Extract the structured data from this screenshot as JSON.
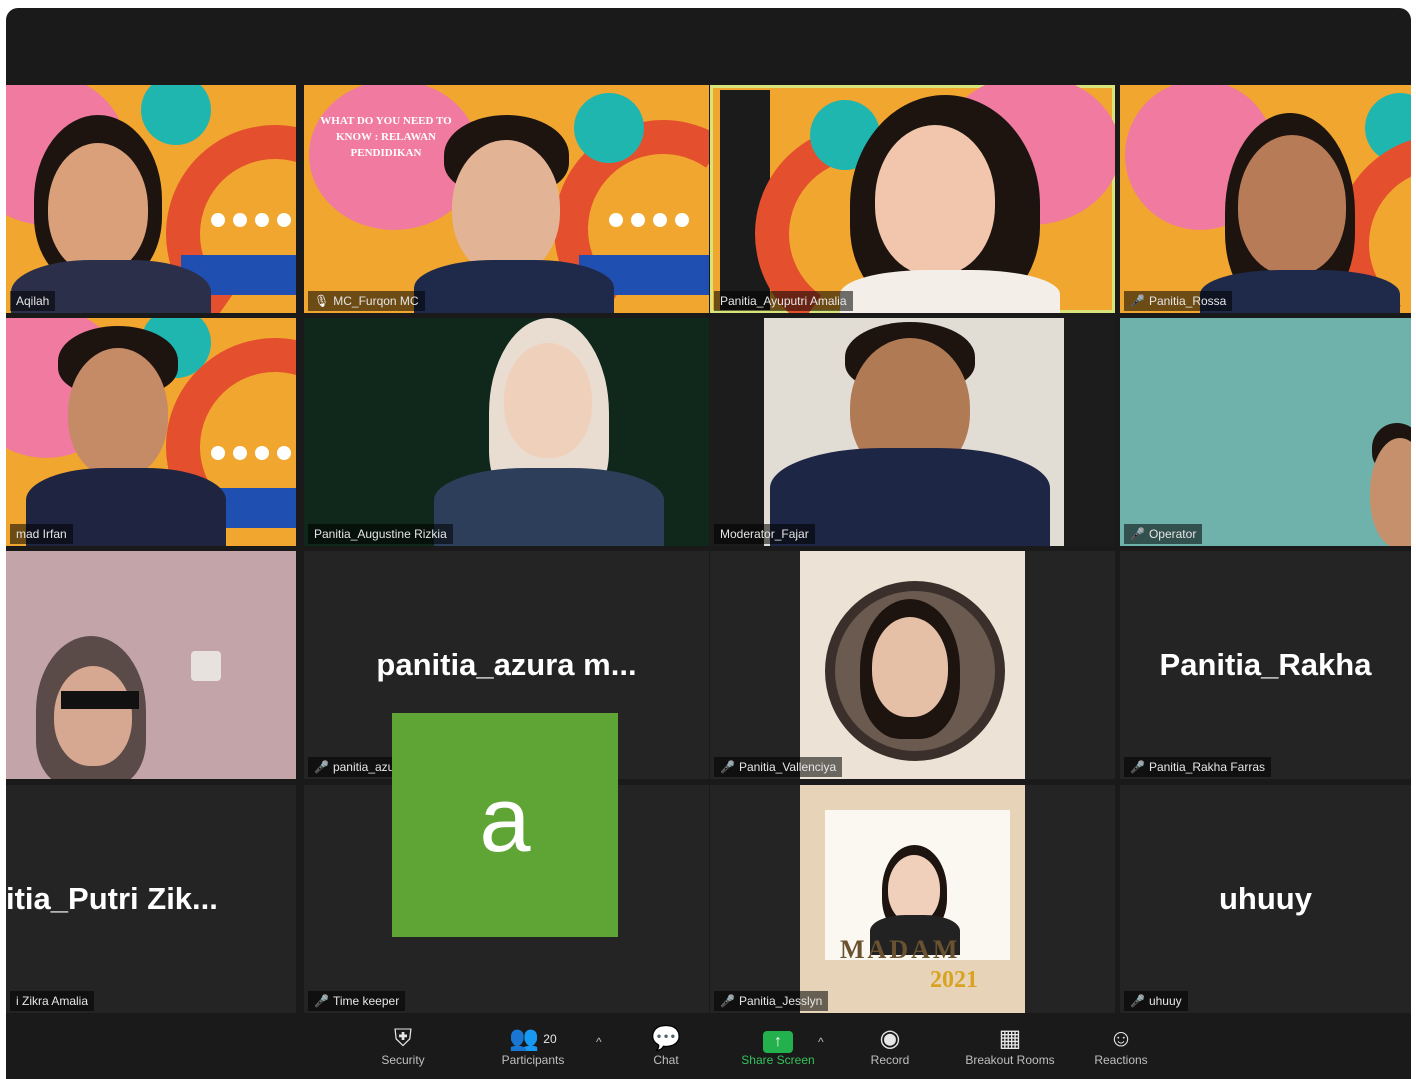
{
  "tiles": [
    {
      "label": "Aqilah",
      "muted": false,
      "mic": false
    },
    {
      "label": "MC_Furqon MC",
      "muted": false,
      "mic": true
    },
    {
      "label": "Panitia_Ayuputri Amalia",
      "muted": false,
      "mic": false
    },
    {
      "label": "Panitia_Rossa",
      "muted": true,
      "mic": false
    },
    {
      "label": "mad Irfan",
      "muted": false,
      "mic": false
    },
    {
      "label": "Panitia_Augustine Rizkia",
      "muted": false,
      "mic": false
    },
    {
      "label": "Moderator_Fajar",
      "muted": false,
      "mic": false
    },
    {
      "label": "Operator",
      "muted": true,
      "mic": false
    },
    {
      "label": "",
      "muted": false,
      "mic": false
    },
    {
      "label": "panitia_azura marha",
      "display": "panitia_azura  m...",
      "muted": true
    },
    {
      "label": "Panitia_Vallenciya",
      "muted": true
    },
    {
      "label": "Panitia_Rakha Farras",
      "display": "Panitia_Rakha",
      "muted": true
    },
    {
      "label": "i Zikra Amalia",
      "display": "itia_Putri  Zik...",
      "muted": false
    },
    {
      "label": "Time keeper",
      "avatar": "a",
      "muted": true
    },
    {
      "label": "Panitia_Jesslyn",
      "muted": true
    },
    {
      "label": "uhuuy",
      "display": "uhuuy",
      "muted": true
    }
  ],
  "slide": {
    "title": "WHAT DO YOU NEED TO KNOW : RELAWAN PENDIDIKAN"
  },
  "frame_text": {
    "madam": "MADAM",
    "year": "2021"
  },
  "toolbar": {
    "security": "Security",
    "participants": "Participants",
    "participants_count": "20",
    "chat": "Chat",
    "share_screen": "Share Screen",
    "record": "Record",
    "breakout_rooms": "Breakout Rooms",
    "reactions": "Reactions"
  },
  "icons": {
    "security": "shield-icon",
    "participants": "people-icon",
    "chat": "chat-bubble-icon",
    "share": "share-screen-icon",
    "record": "record-icon",
    "breakout": "grid-icon",
    "reactions": "smiley-icon"
  },
  "colors": {
    "share_green": "#35c25b",
    "muted_red": "#e0473f",
    "avatar_green": "#5fa535",
    "active_speaker": "#d8e37a"
  }
}
